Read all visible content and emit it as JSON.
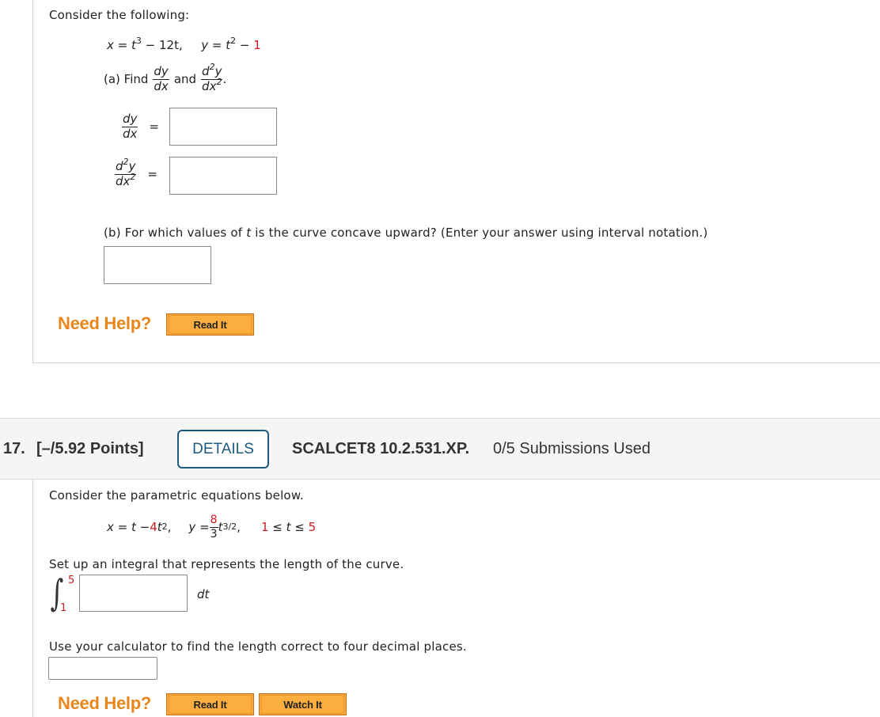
{
  "problem16": {
    "intro": "Consider the following:",
    "equations": {
      "x_lhs": "x = ",
      "x_base": "t",
      "x_exp": "3",
      "x_rest": " − 12t,",
      "y_lhs": "y = ",
      "y_base": "t",
      "y_exp": "2",
      "y_minus": " − ",
      "y_const": "1"
    },
    "part_a": {
      "prefix": "(a) Find",
      "and": "and",
      "period": ".",
      "dy": "dy",
      "dx": "dx",
      "d2y_d": "d",
      "d2y_exp": "2",
      "d2y_y": "y",
      "dx2_dx": "dx",
      "dx2_exp": "2",
      "equals": "=",
      "answer1_value": "",
      "answer2_value": ""
    },
    "part_b": {
      "prefix": "(b) For which values of ",
      "var": "t",
      "suffix": " is the curve concave upward? (Enter your answer using interval notation.)",
      "answer_value": ""
    },
    "need_help": "Need Help?",
    "buttons": {
      "read_it": "Read It"
    }
  },
  "problem17": {
    "header": {
      "number": "17.",
      "points": "[–/5.92 Points]",
      "details_label": "DETAILS",
      "code": "SCALCET8 10.2.531.XP.",
      "submissions": "0/5 Submissions Used"
    },
    "intro": "Consider the parametric equations below.",
    "equations": {
      "x_lhs": "x = t − ",
      "x_coef": "4",
      "x_base": "t",
      "x_exp": "2",
      "x_comma": ",",
      "y_lhs": "y = ",
      "y_num": "8",
      "y_den": "3",
      "y_base": "t",
      "y_exp": "3/2",
      "y_comma": ",",
      "range_low": "1",
      "range_mid": " ≤ t ≤ ",
      "range_high": "5"
    },
    "integral_prompt": "Set up an integral that represents the length of the curve.",
    "integral": {
      "symbol": "∫",
      "upper": "5",
      "lower": "1",
      "differential": "dt",
      "integrand_value": ""
    },
    "length_prompt": "Use your calculator to find the length correct to four decimal places.",
    "length_value": "",
    "need_help": "Need Help?",
    "buttons": {
      "read_it": "Read It",
      "watch_it": "Watch It"
    }
  }
}
